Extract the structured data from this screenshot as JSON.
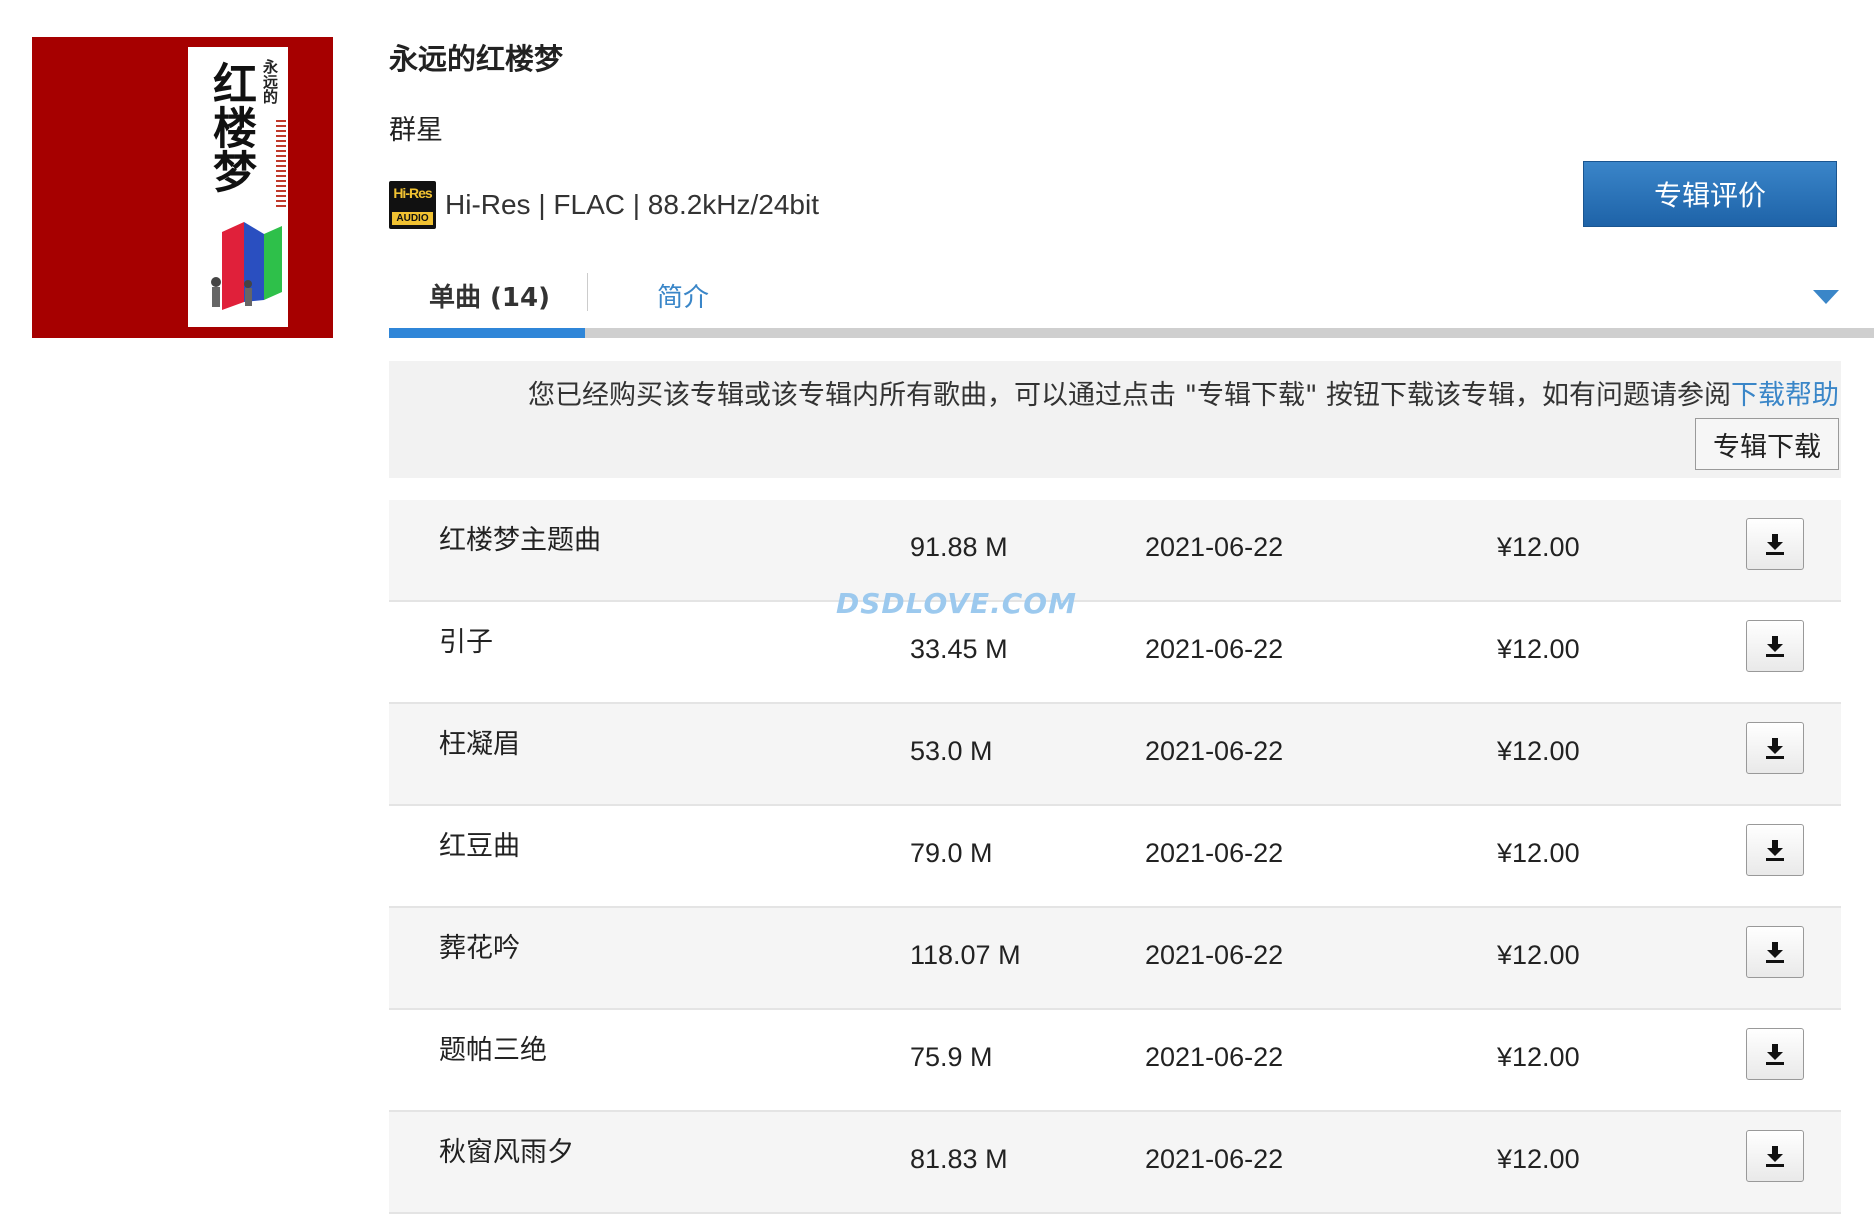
{
  "album": {
    "title": "永远的红楼梦",
    "artist": "群星",
    "format": "Hi-Res | FLAC | 88.2kHz/24bit",
    "cover": {
      "title": "红楼梦",
      "subtitle": "永远的",
      "background": "#a60000"
    },
    "hires_badge": {
      "top": "Hi-Res",
      "bottom": "AUDIO"
    }
  },
  "review_button": "专辑评价",
  "tabs": [
    {
      "label": "单曲 (14)",
      "active": true
    },
    {
      "label": "简介",
      "active": false
    }
  ],
  "notice": {
    "text": "您已经购买该专辑或该专辑内所有歌曲，可以通过点击 \"专辑下载\" 按钮下载该专辑，如有问题请参阅",
    "link": "下载帮助",
    "button": "专辑下载"
  },
  "tracks": [
    {
      "name": "红楼梦主题曲",
      "size": "91.88 M",
      "date": "2021-06-22",
      "price": "¥12.00"
    },
    {
      "name": "引子",
      "size": "33.45 M",
      "date": "2021-06-22",
      "price": "¥12.00"
    },
    {
      "name": "枉凝眉",
      "size": "53.0 M",
      "date": "2021-06-22",
      "price": "¥12.00"
    },
    {
      "name": "红豆曲",
      "size": "79.0 M",
      "date": "2021-06-22",
      "price": "¥12.00"
    },
    {
      "name": "葬花吟",
      "size": "118.07 M",
      "date": "2021-06-22",
      "price": "¥12.00"
    },
    {
      "name": "题帕三绝",
      "size": "75.9 M",
      "date": "2021-06-22",
      "price": "¥12.00"
    },
    {
      "name": "秋窗风雨夕",
      "size": "81.83 M",
      "date": "2021-06-22",
      "price": "¥12.00"
    }
  ],
  "watermark": "DSDLOVE.COM",
  "colors": {
    "accent": "#2f86d8",
    "link": "#3a86c8",
    "button": "#1e63a8"
  }
}
